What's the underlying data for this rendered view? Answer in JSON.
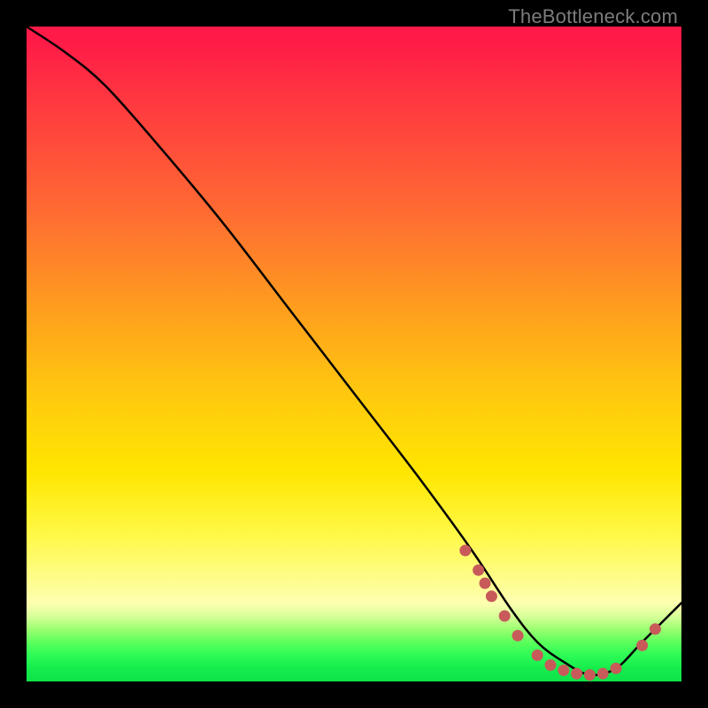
{
  "credit": "TheBottleneck.com",
  "chart_data": {
    "type": "line",
    "title": "",
    "xlabel": "",
    "ylabel": "",
    "xlim": [
      0,
      100
    ],
    "ylim": [
      0,
      100
    ],
    "series": [
      {
        "name": "curve",
        "x": [
          0,
          6,
          12,
          20,
          30,
          40,
          50,
          60,
          68,
          74,
          78,
          82,
          86,
          90,
          94,
          100
        ],
        "y": [
          100,
          96,
          91,
          82,
          70,
          57,
          44,
          31,
          20,
          11,
          6,
          3,
          1,
          2,
          6,
          12
        ]
      }
    ],
    "markers": {
      "name": "highlight-points",
      "color": "#c85a5a",
      "x": [
        67,
        69,
        70,
        71,
        73,
        75,
        78,
        80,
        82,
        84,
        86,
        88,
        90,
        94,
        96
      ],
      "y": [
        20,
        17,
        15,
        13,
        10,
        7,
        4,
        2.5,
        1.7,
        1.2,
        1,
        1.2,
        2,
        5.5,
        8
      ]
    }
  }
}
